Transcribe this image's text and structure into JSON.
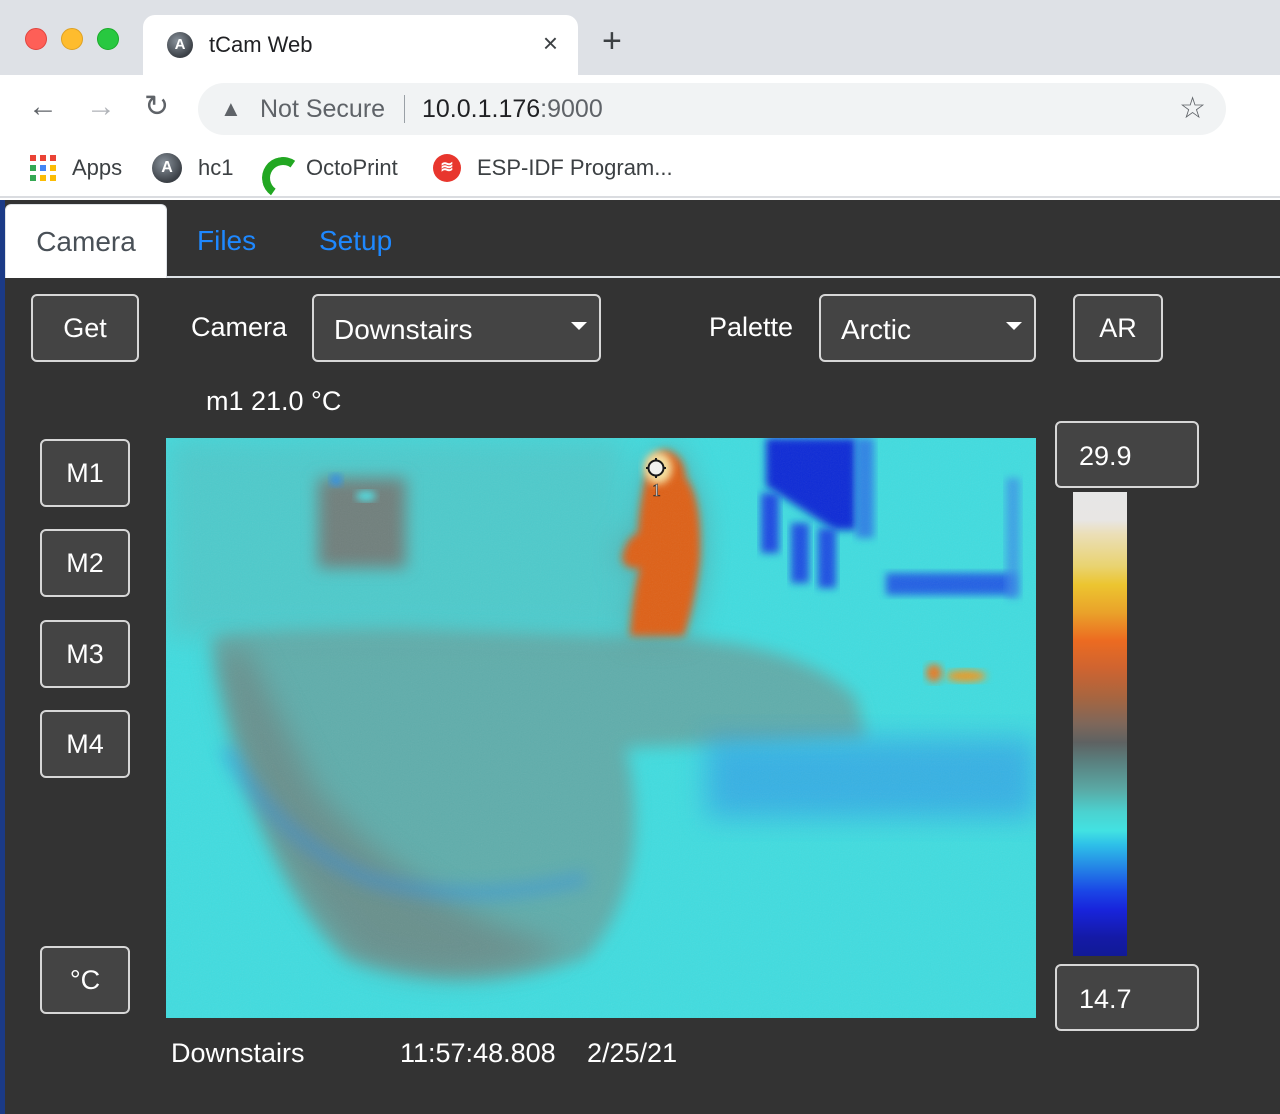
{
  "browser": {
    "tab": {
      "title": "tCam Web",
      "favicon": "app-store-style-icon",
      "close": "×"
    },
    "new_tab": "+",
    "nav": {
      "back": "←",
      "forward": "→",
      "reload": "↻"
    },
    "omnibox": {
      "security_icon": "▲",
      "security_label": "Not Secure",
      "host": "10.0.1.176",
      "port": ":9000",
      "bookmark_star": "☆"
    },
    "bookmarks": [
      {
        "label": "Apps",
        "icon": "apps-grid-icon"
      },
      {
        "label": "hc1",
        "icon": "hc1-icon"
      },
      {
        "label": "OctoPrint",
        "icon": "octoprint-icon"
      },
      {
        "label": "ESP-IDF Program...",
        "icon": "espressif-icon"
      }
    ]
  },
  "app": {
    "tabs": [
      {
        "label": "Camera",
        "active": true
      },
      {
        "label": "Files",
        "active": false
      },
      {
        "label": "Setup",
        "active": false
      }
    ],
    "controls": {
      "get_label": "Get",
      "camera_label": "Camera",
      "camera_selected": "Downstairs",
      "palette_label": "Palette",
      "palette_selected": "Arctic",
      "ar_label": "AR"
    },
    "marker_readout": "m1 21.0 °C",
    "marker_buttons": [
      "M1",
      "M2",
      "M3",
      "M4"
    ],
    "units_button": "°C",
    "marker_overlay_label": "1",
    "range": {
      "max": "29.9",
      "min": "14.7"
    },
    "palette_colors": {
      "hot": "#e6e6e6",
      "warm": "#ec6b21",
      "mid": "#5e6262",
      "cool": "#42e2e2",
      "cold": "#111a96"
    },
    "status": {
      "camera_name": "Downstairs",
      "timestamp": "11:57:48.808",
      "date": "2/25/21"
    }
  }
}
